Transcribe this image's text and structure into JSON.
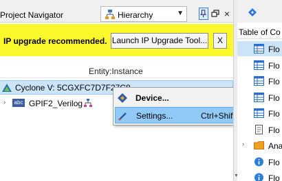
{
  "navigator": {
    "title": "Project Navigator",
    "view_selector": {
      "selected": "Hierarchy",
      "icon": "hierarchy-icon"
    },
    "toolbar": {
      "pin_icon": "pin-icon",
      "restore_icon": "restore-icon",
      "close_icon": "close-icon",
      "close_glyph": "×"
    },
    "ip_banner": {
      "message": "IP upgrade recommended.",
      "launch_button": "Launch IP Upgrade Tool...",
      "close_button": "X",
      "background": "#fbf82c"
    },
    "column_header": "Entity:Instance",
    "device_row": {
      "label": "Cyclone V: 5CGXFC7D7F27C8",
      "icon": "device-triangle-icon"
    },
    "entity_row": {
      "expander": "›",
      "icon_text": "abc",
      "label": "GPIF2_Verilog",
      "icon": "hierarchy-small-icon"
    }
  },
  "context_menu": {
    "items": [
      {
        "label": "Device...",
        "shortcut": "",
        "bold": true,
        "icon": "device-diamond-icon"
      },
      {
        "label": "Settings...",
        "shortcut": "Ctrl+Shift+E",
        "bold": false,
        "highlighted": true,
        "icon": "settings-pencil-icon"
      }
    ],
    "highlight_color": "#91c9f7"
  },
  "right_pane": {
    "tab_icon": "tasks-icon",
    "header": "Table of Co",
    "rows": [
      {
        "arrow": "",
        "icon": "table-icon",
        "label": "Flo",
        "selected": true
      },
      {
        "arrow": "",
        "icon": "table-icon",
        "label": "Flo",
        "selected": false
      },
      {
        "arrow": "",
        "icon": "table-icon",
        "label": "Flo",
        "selected": false
      },
      {
        "arrow": "",
        "icon": "table-icon",
        "label": "Flo",
        "selected": false
      },
      {
        "arrow": "",
        "icon": "table-icon",
        "label": "Flo",
        "selected": false
      },
      {
        "arrow": "",
        "icon": "document-icon",
        "label": "Flo",
        "selected": false
      },
      {
        "arrow": "›",
        "icon": "folder-icon",
        "label": "Ana",
        "selected": false
      },
      {
        "arrow": "",
        "icon": "info-icon",
        "label": "Flo",
        "selected": false
      },
      {
        "arrow": "",
        "icon": "info-icon",
        "label": "Flo",
        "selected": false
      }
    ],
    "scroll_down_glyph": "▼"
  }
}
